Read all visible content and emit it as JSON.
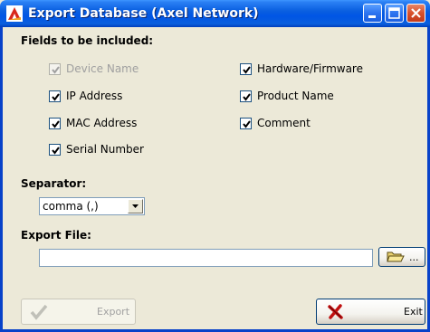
{
  "window": {
    "title": "Export Database (Axel Network)"
  },
  "fields_section": {
    "heading": "Fields to be included:",
    "left_column": [
      {
        "label": "Device Name",
        "checked": true,
        "enabled": false
      },
      {
        "label": "IP Address",
        "checked": true,
        "enabled": true
      },
      {
        "label": "MAC Address",
        "checked": true,
        "enabled": true
      },
      {
        "label": "Serial Number",
        "checked": true,
        "enabled": true
      }
    ],
    "right_column": [
      {
        "label": "Hardware/Firmware",
        "checked": true,
        "enabled": true
      },
      {
        "label": "Product Name",
        "checked": true,
        "enabled": true
      },
      {
        "label": "Comment",
        "checked": true,
        "enabled": true
      }
    ]
  },
  "separator": {
    "heading": "Separator:",
    "selected": "comma (,)"
  },
  "export_file": {
    "heading": "Export File:",
    "value": "",
    "browse_label": "..."
  },
  "buttons": {
    "export_label": "Export",
    "exit_label": "Exit"
  },
  "colors": {
    "titlebar": "#0055e5",
    "window_bg": "#ece9d8",
    "close_button": "#d8512c"
  }
}
